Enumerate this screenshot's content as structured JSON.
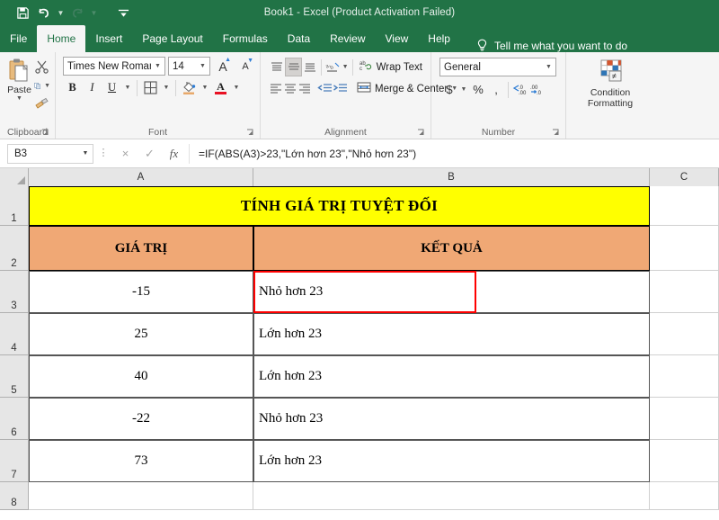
{
  "titlebar": {
    "window_title": "Book1  -  Excel (Product Activation Failed)",
    "qat": [
      {
        "name": "save-icon",
        "label": "Save"
      },
      {
        "name": "undo-icon",
        "label": "Undo"
      },
      {
        "name": "redo-icon",
        "label": "Redo"
      },
      {
        "name": "customize-qat-icon",
        "label": "Customize Quick Access Toolbar"
      }
    ]
  },
  "ribbon": {
    "tabs": [
      {
        "label": "File",
        "active": false
      },
      {
        "label": "Home",
        "active": true
      },
      {
        "label": "Insert",
        "active": false
      },
      {
        "label": "Page Layout",
        "active": false
      },
      {
        "label": "Formulas",
        "active": false
      },
      {
        "label": "Data",
        "active": false
      },
      {
        "label": "Review",
        "active": false
      },
      {
        "label": "View",
        "active": false
      },
      {
        "label": "Help",
        "active": false
      }
    ],
    "tellme": "Tell me what you want to do",
    "groups": {
      "clipboard": {
        "label": "Clipboard",
        "paste_label": "Paste",
        "cut_label": "Cut",
        "copy_label": "Copy",
        "format_painter_label": "Format Painter"
      },
      "font": {
        "label": "Font",
        "font_name": "Times New Roman",
        "font_size": "14",
        "grow_font_label": "A",
        "shrink_font_label": "A",
        "bold_label": "B",
        "italic_label": "I",
        "underline_label": "U",
        "borders_label": "Borders",
        "fill_color_label": "Fill Color",
        "font_color_label": "A"
      },
      "alignment": {
        "label": "Alignment",
        "wrap_text": "Wrap Text",
        "merge_center": "Merge & Center",
        "top_align": "Top Align",
        "middle_align": "Middle Align",
        "bottom_align": "Bottom Align",
        "orientation": "Orientation",
        "align_left": "Align Left",
        "center": "Center",
        "align_right": "Align Right",
        "decrease_indent": "Decrease Indent",
        "increase_indent": "Increase Indent"
      },
      "number": {
        "label": "Number",
        "format": "General",
        "accounting": "$",
        "percent": "%",
        "comma": ",",
        "increase_decimal": ".00",
        "decrease_decimal": ".00"
      },
      "styles": {
        "conditional_formatting_line1": "Condition",
        "conditional_formatting_line2": "Formatting"
      }
    }
  },
  "formulabar": {
    "name_box": "B3",
    "cancel_label": "×",
    "enter_label": "✓",
    "fx_label": "fx",
    "formula": "=IF(ABS(A3)>23,\"Lớn hơn 23\",\"Nhỏ hơn 23\")"
  },
  "grid": {
    "columns": [
      "A",
      "B",
      "C"
    ],
    "row_numbers": [
      "1",
      "2",
      "3",
      "4",
      "5",
      "6",
      "7",
      "8"
    ],
    "title": "TÍNH GIÁ TRỊ TUYỆT ĐỐI",
    "headers": {
      "a": "GIÁ TRỊ",
      "b": "KẾT QUẢ"
    },
    "rows": [
      {
        "value": "-15",
        "result": "Nhỏ hơn 23"
      },
      {
        "value": "25",
        "result": "Lớn hơn 23"
      },
      {
        "value": "40",
        "result": "Lớn hơn 23"
      },
      {
        "value": "-22",
        "result": "Nhỏ hơn 23"
      },
      {
        "value": "73",
        "result": "Lớn hơn 23"
      }
    ],
    "selected_cell": "B3"
  },
  "colors": {
    "brand_green": "#217346",
    "title_fill": "#ffff00",
    "header_fill": "#f0a875",
    "selection_red": "#ff0000"
  }
}
